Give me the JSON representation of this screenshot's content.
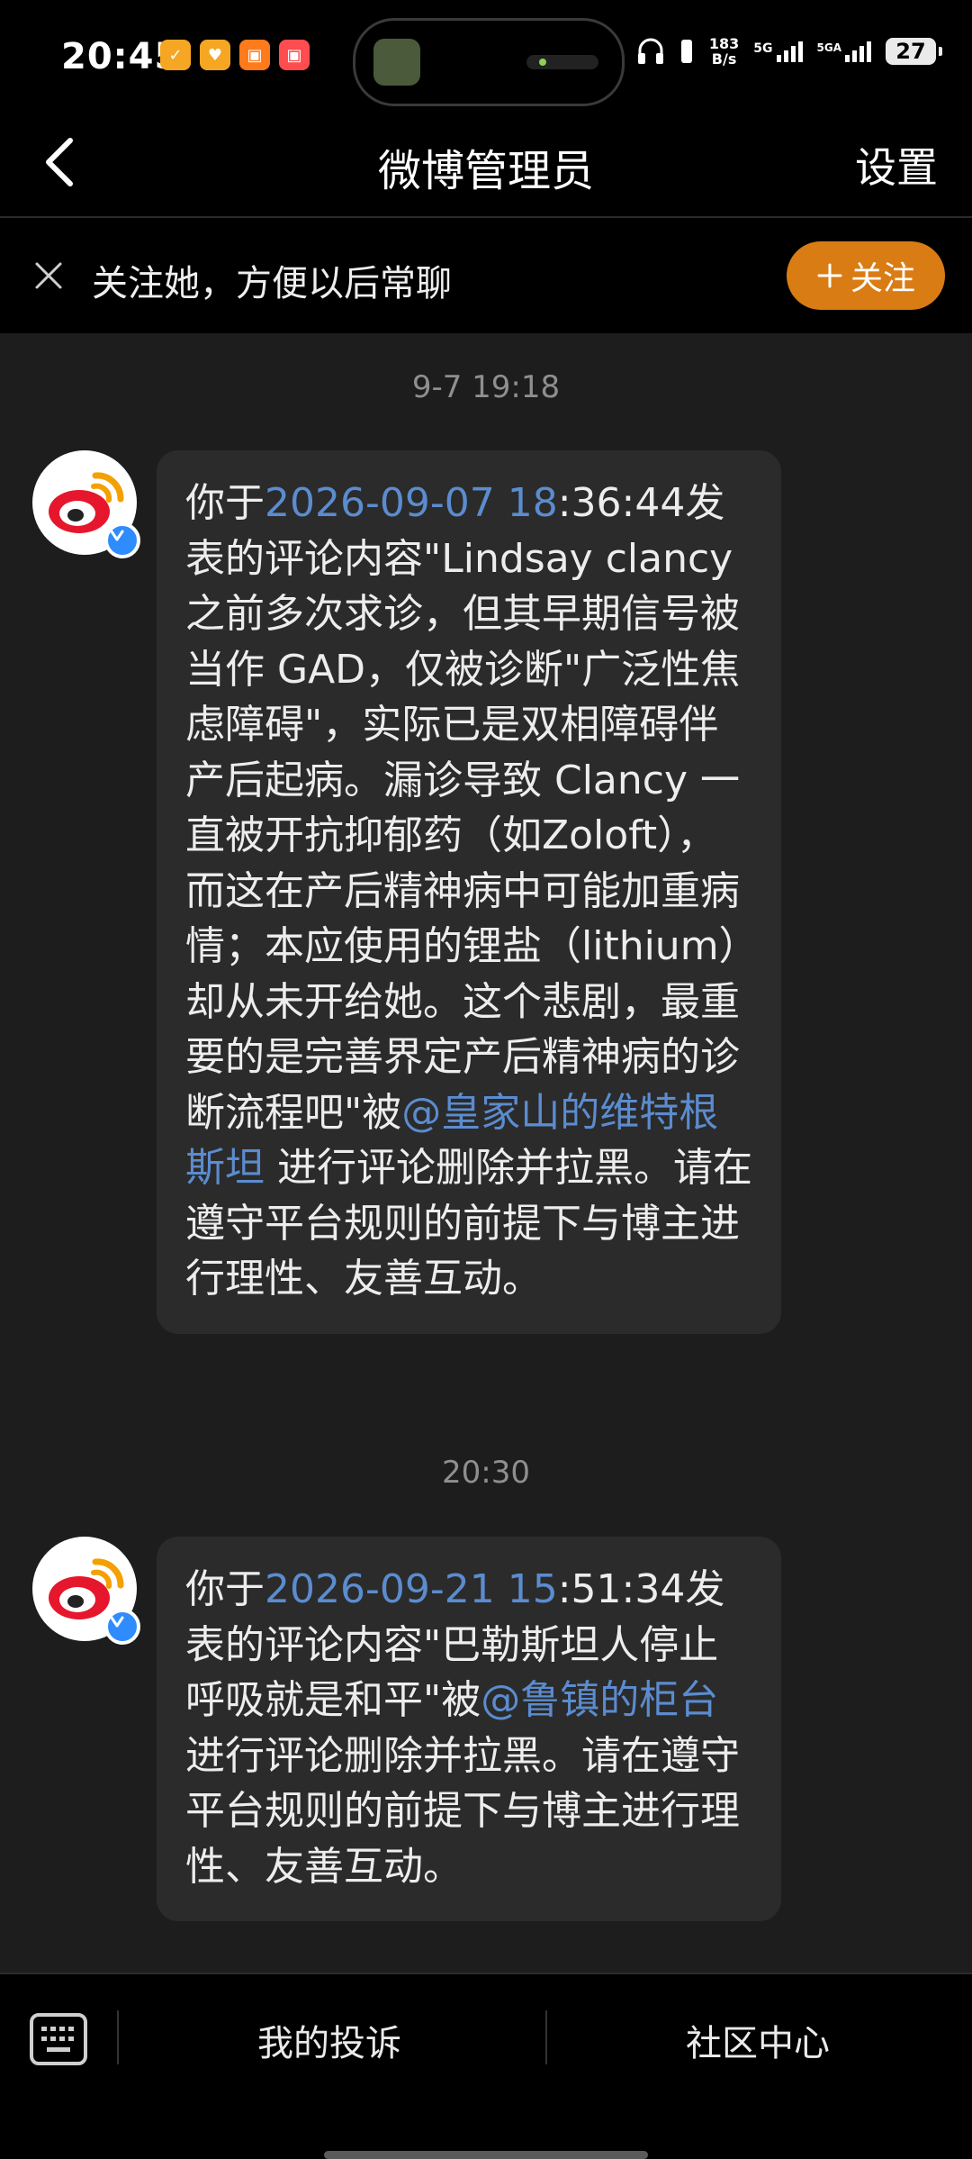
{
  "status_bar": {
    "time": "20:45",
    "app_icons": [
      "app-icon-1",
      "app-icon-2",
      "app-icon-3",
      "app-icon-4"
    ],
    "net_speed": "183",
    "net_speed_unit": "B/s",
    "signal_1": "5G",
    "signal_2": "5GA",
    "battery": "27"
  },
  "header": {
    "title": "微博管理员",
    "settings_label": "设置"
  },
  "follow_banner": {
    "text": "关注她，方便以后常聊",
    "button_label": "关注",
    "accent_color": "#d97c14"
  },
  "messages": [
    {
      "timestamp": "9-7 19:18",
      "segments": [
        {
          "text": "你于",
          "link": false
        },
        {
          "text": "2026-09-07 18",
          "link": true
        },
        {
          "text": ":36:44发表的评论内容\"Lindsay clancy之前多次求诊，但其早期信号被当作 GAD，仅被诊断\"广泛性焦虑障碍\"，实际已是双相障碍伴产后起病。漏诊导致 Clancy 一直被开抗抑郁药（如Zoloft），而这在产后精神病中可能加重病情；本应使用的锂盐（lithium）却从未开给她。这个悲剧，最重要的是完善界定产后精神病的诊断流程吧\"被",
          "link": false
        },
        {
          "text": "@皇家山的维特根斯坦",
          "link": true
        },
        {
          "text": " 进行评论删除并拉黑。请在遵守平台规则的前提下与博主进行理性、友善互动。",
          "link": false
        }
      ]
    },
    {
      "timestamp": "20:30",
      "segments": [
        {
          "text": "你于",
          "link": false
        },
        {
          "text": "2026-09-21 15",
          "link": true
        },
        {
          "text": ":51:34发表的评论内容\"巴勒斯坦人停止呼吸就是和平\"被",
          "link": false
        },
        {
          "text": "@鲁镇的柜台",
          "link": true
        },
        {
          "text": "进行评论删除并拉黑。请在遵守平台规则的前提下与博主进行理性、友善互动。",
          "link": false
        }
      ]
    }
  ],
  "bottom_bar": {
    "complaint_label": "我的投诉",
    "community_label": "社区中心"
  },
  "colors": {
    "link": "#5b8ccf",
    "bubble": "#2b2b2b",
    "background": "#1d1d1d",
    "verified": "#2f8cff"
  }
}
